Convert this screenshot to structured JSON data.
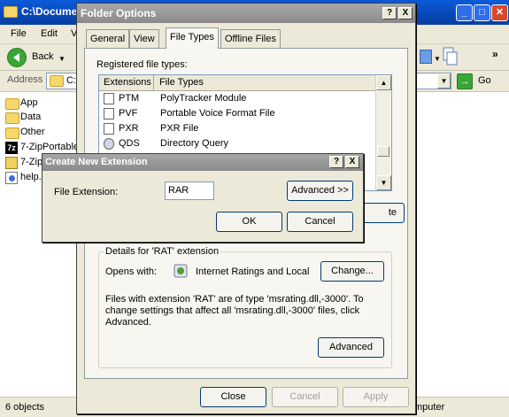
{
  "explorer": {
    "title": "C:\\Docume",
    "menu": [
      "File",
      "Edit",
      "V"
    ],
    "back_label": "Back",
    "address_label": "Address",
    "address_value": "C:",
    "go_label": "Go",
    "overflow_label": "»",
    "tree_items": [
      "App",
      "Data",
      "Other",
      "7-ZipPortable",
      "7-Zip",
      "help."
    ],
    "status_left": "6 objects",
    "status_right": "mputer"
  },
  "folder_options": {
    "title": "Folder Options",
    "help_btn": "?",
    "close_btn": "X",
    "tabs": [
      "General",
      "View",
      "File Types",
      "Offline Files"
    ],
    "active_tab": "File Types",
    "registered_label": "Registered file types:",
    "columns": [
      "Extensions",
      "File Types"
    ],
    "rows": [
      {
        "ext": "PTM",
        "type": "PolyTracker Module"
      },
      {
        "ext": "PVF",
        "type": "Portable Voice Format File"
      },
      {
        "ext": "PXR",
        "type": "PXR File"
      },
      {
        "ext": "QDS",
        "type": "Directory Query"
      }
    ],
    "partial_button": "te",
    "details_label": "Details for 'RAT' extension",
    "opens_with_label": "Opens with:",
    "opens_with_app": "Internet Ratings and Local",
    "change_btn": "Change...",
    "description": "Files with extension 'RAT' are of type 'msrating.dll,-3000'.  To change settings that affect all 'msrating.dll,-3000' files, click Advanced.",
    "advanced_btn": "Advanced",
    "close_btn_label": "Close",
    "cancel_btn": "Cancel",
    "apply_btn": "Apply"
  },
  "create_ext": {
    "title": "Create New Extension",
    "help_btn": "?",
    "close_btn": "X",
    "field_label": "File Extension:",
    "field_value": "RAR",
    "advanced_btn": "Advanced >>",
    "ok_btn": "OK",
    "cancel_btn": "Cancel"
  }
}
